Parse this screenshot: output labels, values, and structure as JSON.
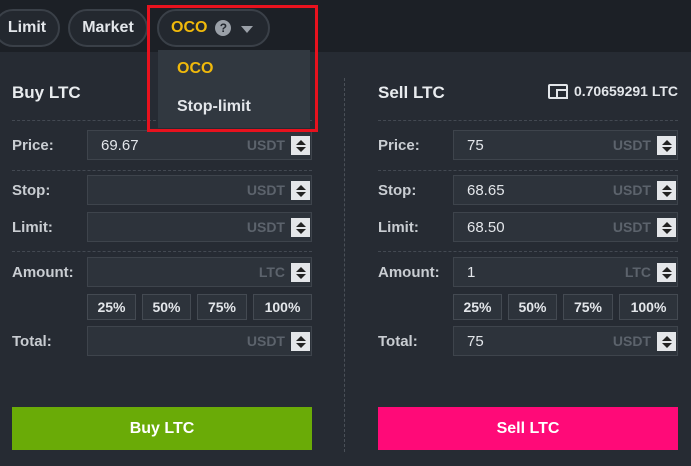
{
  "tabs": {
    "limit": "Limit",
    "market": "Market",
    "oco": "OCO"
  },
  "dropdown": {
    "items": [
      "OCO",
      "Stop-limit"
    ]
  },
  "buy": {
    "title": "Buy LTC",
    "price_label": "Price:",
    "price_value": "69.67",
    "price_unit": "USDT",
    "stop_label": "Stop:",
    "stop_value": "",
    "stop_unit": "USDT",
    "limit_label": "Limit:",
    "limit_value": "",
    "limit_unit": "USDT",
    "amount_label": "Amount:",
    "amount_value": "",
    "amount_unit": "LTC",
    "percents": [
      "25%",
      "50%",
      "75%",
      "100%"
    ],
    "total_label": "Total:",
    "total_value": "",
    "total_unit": "USDT",
    "button": "Buy LTC"
  },
  "sell": {
    "title": "Sell LTC",
    "balance": "0.70659291 LTC",
    "price_label": "Price:",
    "price_value": "75",
    "price_unit": "USDT",
    "stop_label": "Stop:",
    "stop_value": "68.65",
    "stop_unit": "USDT",
    "limit_label": "Limit:",
    "limit_value": "68.50",
    "limit_unit": "USDT",
    "amount_label": "Amount:",
    "amount_value": "1",
    "amount_unit": "LTC",
    "percents": [
      "25%",
      "50%",
      "75%",
      "100%"
    ],
    "total_label": "Total:",
    "total_value": "75",
    "total_unit": "USDT",
    "button": "Sell LTC"
  },
  "colors": {
    "accent": "#f0b90b",
    "buy": "#6aab07",
    "sell": "#ff0a78",
    "highlight": "#e8121e",
    "background": "#262b33"
  },
  "icons": {
    "help": "question-circle-icon",
    "dropdown": "chevron-down-icon",
    "wallet": "wallet-icon",
    "spinner": "spinner-arrows-icon"
  }
}
